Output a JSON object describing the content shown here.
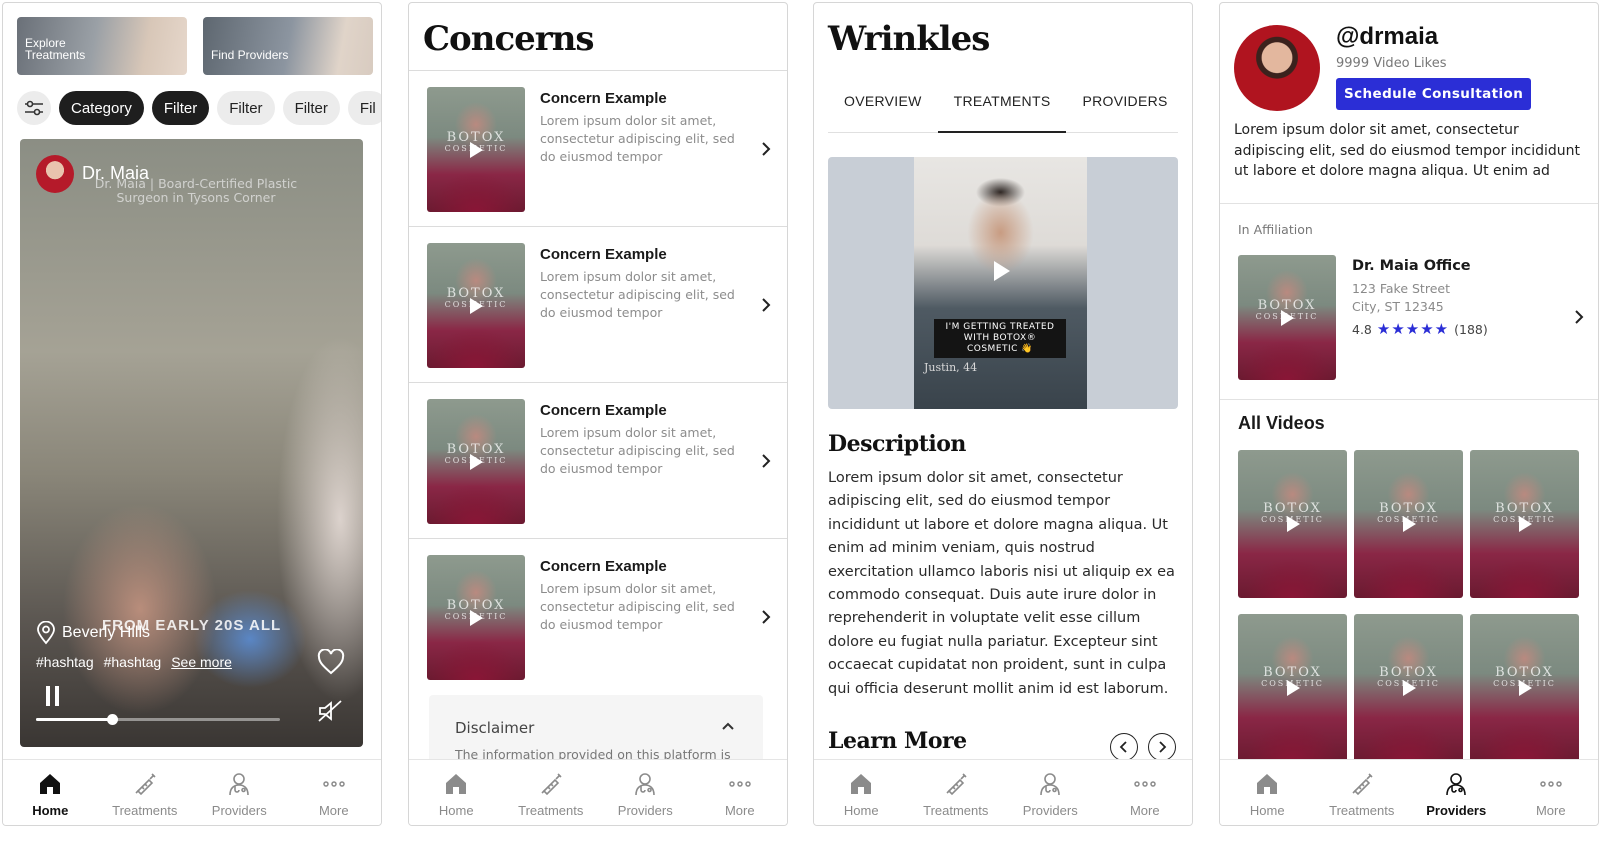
{
  "nav": {
    "items": [
      {
        "label": "Home",
        "icon": "home-icon"
      },
      {
        "label": "Treatments",
        "icon": "syringe-icon"
      },
      {
        "label": "Providers",
        "icon": "provider-icon"
      },
      {
        "label": "More",
        "icon": "more-dots-icon"
      }
    ]
  },
  "screen1": {
    "promos": [
      "Explore Treatments",
      "Find Providers"
    ],
    "filters": [
      "Category",
      "Filter",
      "Filter",
      "Filter",
      "Fil"
    ],
    "video": {
      "author": "Dr. Maia",
      "caption": "Dr. Maia | Board-Certified Plastic Surgeon in Tysons Corner",
      "overlay_text": "FROM EARLY 20S ALL",
      "location": "Beverly Hills",
      "tags": [
        "#hashtag",
        "#hashtag"
      ],
      "see_more": "See more",
      "progress": 0.31
    },
    "active_nav": "Home"
  },
  "screen2": {
    "title": "Concerns",
    "thumb_brand": "BOTOX",
    "thumb_sub": "COSMETIC",
    "concerns": [
      {
        "title": "Concern Example",
        "desc": "Lorem ipsum dolor sit amet, consectetur adipiscing elit, sed do eiusmod tempor"
      },
      {
        "title": "Concern Example",
        "desc": "Lorem ipsum dolor sit amet, consectetur adipiscing elit, sed do eiusmod tempor"
      },
      {
        "title": "Concern Example",
        "desc": "Lorem ipsum dolor sit amet, consectetur adipiscing elit, sed do eiusmod tempor"
      },
      {
        "title": "Concern Example",
        "desc": "Lorem ipsum dolor sit amet, consectetur adipiscing elit, sed do eiusmod tempor"
      }
    ],
    "disclaimer": {
      "title": "Disclaimer",
      "text": "The information provided on this platform is"
    }
  },
  "screen3": {
    "title": "Wrinkles",
    "tabs": [
      "OVERVIEW",
      "TREATMENTS",
      "PROVIDERS"
    ],
    "active_tab": "TREATMENTS",
    "video": {
      "label": "I'M GETTING TREATED WITH BOTOX® COSMETIC 👋",
      "caption": "Justin, 44"
    },
    "description_title": "Description",
    "description": "Lorem ipsum dolor sit amet, consectetur adipiscing elit, sed do eiusmod tempor incididunt ut labore et dolore magna aliqua. Ut enim ad minim veniam, quis nostrud exercitation ullamco laboris nisi ut aliquip ex ea commodo consequat. Duis aute irure dolor in reprehenderit in voluptate velit esse cillum dolore eu fugiat nulla pariatur. Excepteur sint occaecat cupidatat non proident, sunt in culpa qui officia deserunt mollit anim id est laborum.",
    "learn_more_title": "Learn More"
  },
  "screen4": {
    "handle": "@drmaia",
    "likes": "9999 Video Likes",
    "cta": "Schedule Consultation",
    "bio": "Lorem ipsum dolor sit amet, consectetur adipiscing elit, sed do eiusmod tempor incididunt ut labore et dolore magna aliqua. Ut enim ad",
    "affiliation_label": "In Affiliation",
    "office": {
      "name": "Dr. Maia Office",
      "street": "123 Fake Street",
      "city": "City, ST 12345",
      "rating": "4.8",
      "stars": 5,
      "count": "(188)"
    },
    "all_videos_title": "All Videos",
    "video_count": 6,
    "active_nav": "Providers"
  },
  "colors": {
    "accent": "#2b2ed6",
    "dark_chip": "#1e1e1e",
    "muted_text": "#8c8c8c"
  }
}
